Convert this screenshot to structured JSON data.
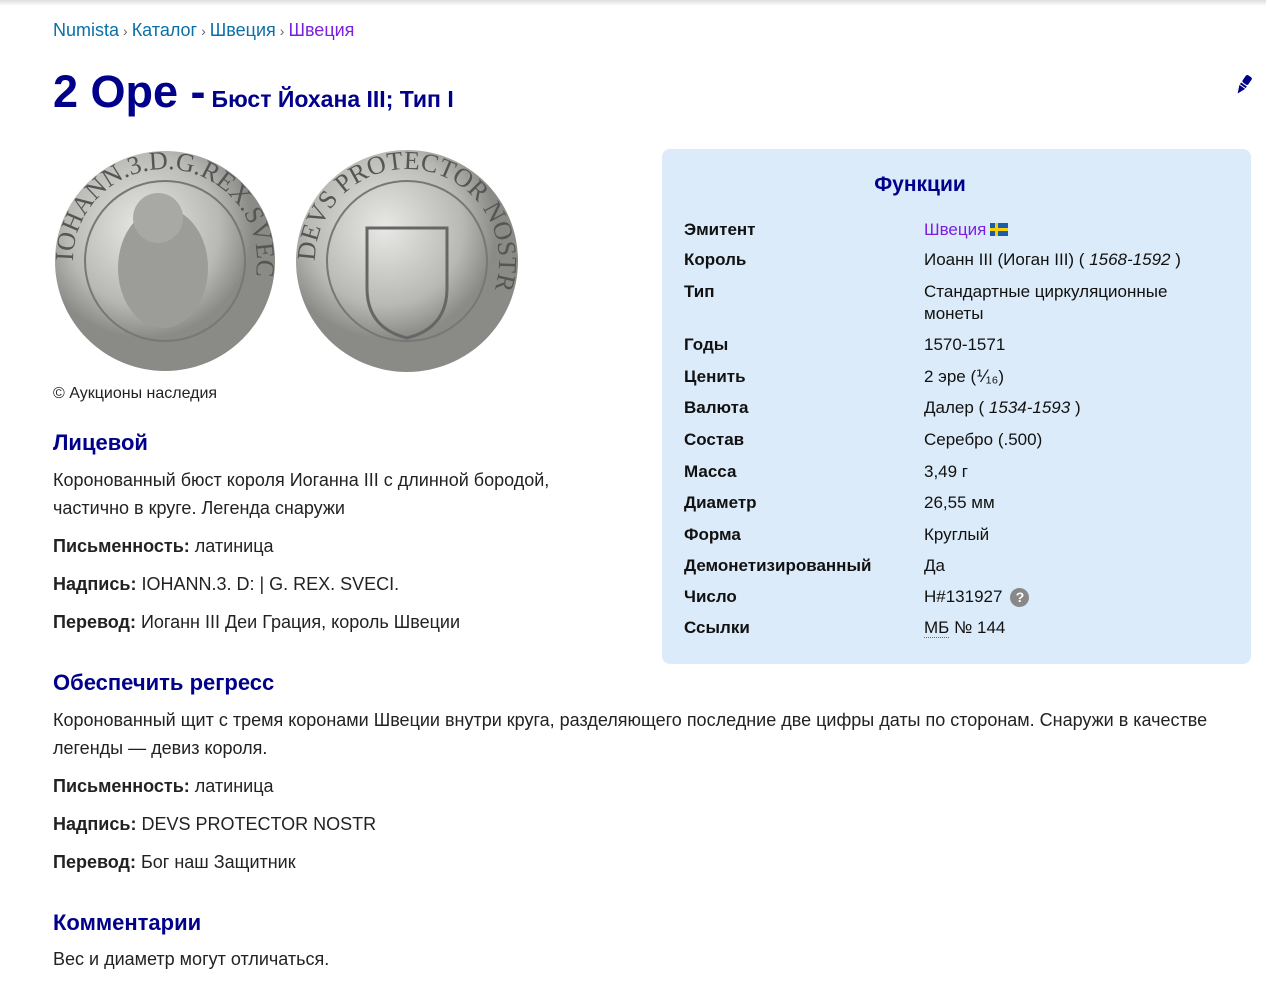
{
  "breadcrumb": [
    "Numista",
    "Каталог",
    "Швеция",
    "Швеция"
  ],
  "title": {
    "main": "2 Ope -",
    "sub": "Бюст Йохана III; Тип I"
  },
  "coins": {
    "obverse_legend": "IOHANN.3.D.G.REX.SVEC",
    "reverse_legend": "DEVS PROTECTOR NOSTR",
    "credit": "© Аукционы наследия"
  },
  "obverse": {
    "heading": "Лицевой",
    "description": "Коронованный бюст короля Иоганна III с длинной бородой, частично в круге. Легенда снаружи",
    "script_label": "Письменность:",
    "script": " латиница",
    "inscription_label": "Надпись:",
    "inscription": " IOHANN.3. D: | G. REX. SVECI.",
    "translation_label": "Перевод:",
    "translation": " Иоганн III Деи Грация, король Швеции"
  },
  "reverse": {
    "heading": "Обеспечить регресс",
    "description": "Коронованный щит с тремя коронами Швеции внутри круга, разделяющего последние две цифры даты по сторонам. Снаружи в качестве легенды — девиз короля.",
    "script_label": "Письменность:",
    "script": " латиница",
    "inscription_label": "Надпись:",
    "inscription": " DEVS PROTECTOR NOSTR",
    "translation_label": "Перевод:",
    "translation": " Бог наш Защитник"
  },
  "comments": {
    "heading": "Комментарии",
    "text": "Вес и диаметр могут отличаться."
  },
  "features": {
    "heading": "Функции",
    "issuer_k": "Эмитент",
    "issuer": "Швеция",
    "king_k": "Король",
    "king": "Иоанн III (Иоган III)",
    "king_years": "1568-1592",
    "type_k": "Тип",
    "type": "Стандартные циркуляционные монеты",
    "years_k": "Годы",
    "years": "1570-1571",
    "value_k": "Ценить",
    "value": "2 эре (⅟₁₆)",
    "currency_k": "Валюта",
    "currency": "Далер",
    "currency_years": "1534-1593",
    "composition_k": "Состав",
    "composition": "Серебро (.500)",
    "weight_k": "Масса",
    "weight": "3,49 г",
    "diameter_k": "Диаметр",
    "diameter": "26,55 мм",
    "shape_k": "Форма",
    "shape": "Круглый",
    "demonetized_k": "Демонетизированный",
    "demonetized": "Да",
    "number_k": "Число",
    "number": "Н#131927",
    "refs_k": "Ссылки",
    "refs_prefix": "МБ",
    "refs": "№ 144"
  },
  "colors": {
    "heading": "#00008b",
    "link": "#0a6fa8",
    "visited": "#7a1ee0",
    "panel": "#dcebf9"
  }
}
